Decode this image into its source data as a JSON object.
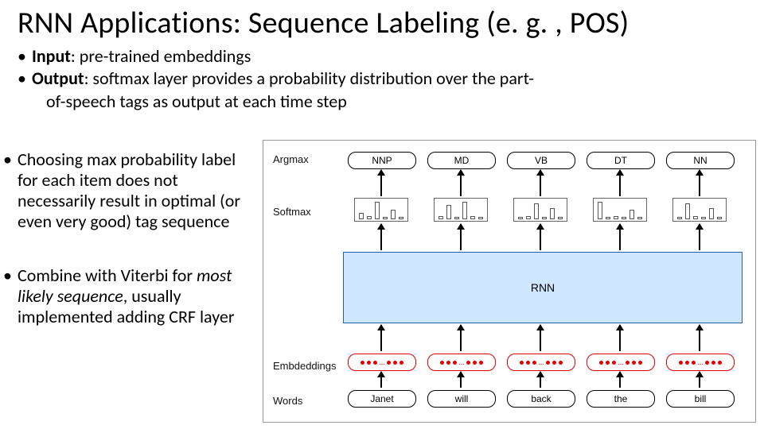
{
  "title": "RNN Applications: Sequence Labeling (e. g. , POS)",
  "bullets_top": {
    "input_label": "Input",
    "input_text": ": pre-trained embeddings",
    "output_label": "Output",
    "output_text_l1": ": softmax layer provides a probability distribution over the part-",
    "output_text_l2": "of-speech tags as output at each time step"
  },
  "bullets_left": {
    "b1": "Choosing  max probability label for each item does not necessarily result in optimal (or even very good) tag sequence",
    "b2_a": "Combine with Viterbi for ",
    "b2_i": "most likely sequence",
    "b2_b": ", usually implemented adding CRF layer"
  },
  "diagram": {
    "row_labels": {
      "argmax": "Argmax",
      "softmax": "Softmax",
      "emb": "Embdeddings",
      "words": "Words"
    },
    "rnn": "RNN",
    "cols": [
      {
        "tag": "NNP",
        "word": "Janet",
        "bars": [
          8,
          4,
          22,
          3,
          12,
          3
        ]
      },
      {
        "tag": "MD",
        "word": "will",
        "bars": [
          4,
          18,
          3,
          22,
          4,
          3
        ]
      },
      {
        "tag": "VB",
        "word": "back",
        "bars": [
          3,
          4,
          20,
          3,
          14,
          3
        ]
      },
      {
        "tag": "DT",
        "word": "the",
        "bars": [
          22,
          3,
          4,
          3,
          12,
          3
        ]
      },
      {
        "tag": "NN",
        "word": "bill",
        "bars": [
          3,
          20,
          4,
          3,
          14,
          3
        ]
      }
    ]
  }
}
